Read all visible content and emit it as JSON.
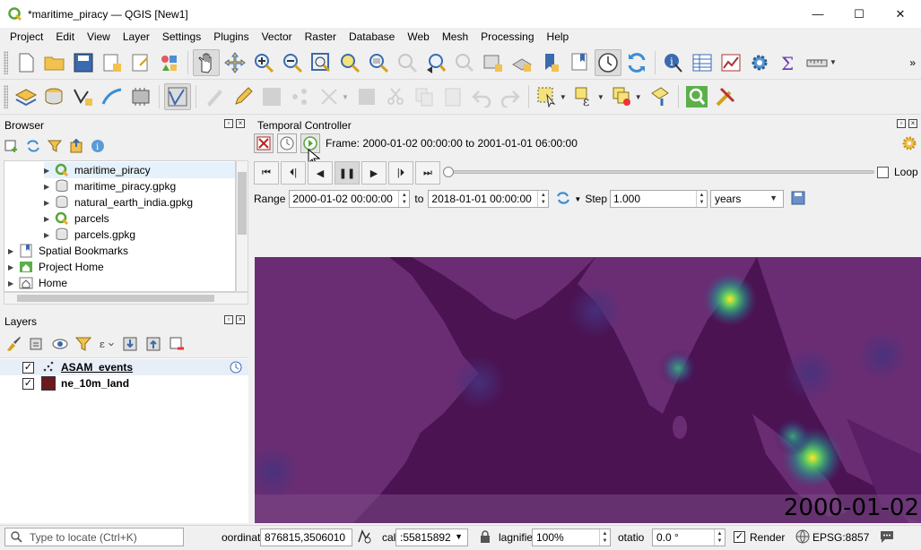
{
  "window": {
    "title": "*maritime_piracy — QGIS [New1]",
    "minimize": "—",
    "maximize": "☐",
    "close": "✕"
  },
  "menu": [
    "Project",
    "Edit",
    "View",
    "Layer",
    "Settings",
    "Plugins",
    "Vector",
    "Raster",
    "Database",
    "Web",
    "Mesh",
    "Processing",
    "Help"
  ],
  "browser": {
    "title": "Browser",
    "items": [
      {
        "label": "maritime_piracy",
        "icon": "qgis-project-icon"
      },
      {
        "label": "maritime_piracy.gpkg",
        "icon": "geopackage-icon"
      },
      {
        "label": "natural_earth_india.gpkg",
        "icon": "geopackage-icon"
      },
      {
        "label": "parcels",
        "icon": "qgis-project-icon"
      },
      {
        "label": "parcels.gpkg",
        "icon": "geopackage-icon"
      },
      {
        "label": "Spatial Bookmarks",
        "icon": "bookmark-icon"
      },
      {
        "label": "Project Home",
        "icon": "project-home-icon"
      },
      {
        "label": "Home",
        "icon": "home-icon"
      }
    ]
  },
  "layers": {
    "title": "Layers",
    "items": [
      {
        "label": "ASAM_events",
        "checked": "✓",
        "icon": "point-layer-icon"
      },
      {
        "label": "ne_10m_land",
        "checked": "✓",
        "icon": "polygon-layer-icon",
        "color": "#6b1a1f"
      }
    ]
  },
  "temporal": {
    "title": "Temporal Controller",
    "frame": "Frame: 2000-01-02 00:00:00 to 2001-01-01 06:00:00",
    "loop_label": "Loop",
    "range_label": "Range",
    "range_start": "2000-01-02 00:00:00",
    "to_label": "to",
    "range_end": "2018-01-01 00:00:00",
    "step_label": "Step",
    "step_value": "1.000",
    "step_unit": "years",
    "progress": 0
  },
  "map": {
    "date_label": "2000-01-02",
    "background": "#4c1351",
    "land_color": "#6b2f74"
  },
  "status": {
    "locate_placeholder": "Type to locate (Ctrl+K)",
    "coord_label": "oordinat",
    "coord_value": "876815,3506010",
    "scale_label": "cal",
    "scale_value": ":55815892",
    "magnifier_label": "lagnifie",
    "magnifier_value": "100%",
    "rotation_label": "otatio",
    "rotation_value": "0.0 °",
    "render_label": "Render",
    "crs": "EPSG:8857"
  }
}
